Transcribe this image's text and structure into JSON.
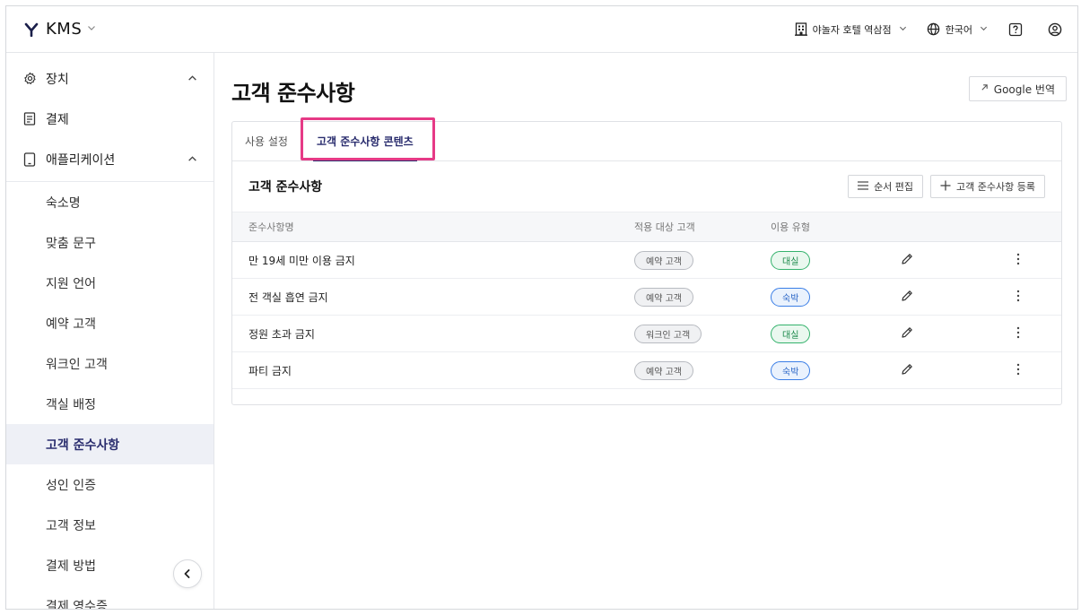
{
  "app": {
    "name": "KMS",
    "property": "야놀자 호텔 역삼점",
    "language": "한국어"
  },
  "sidebar": {
    "groups": [
      {
        "label": "장치",
        "icon": "gear-icon",
        "expanded": true
      },
      {
        "label": "결제",
        "icon": "receipt-icon"
      },
      {
        "label": "애플리케이션",
        "icon": "tablet-icon",
        "expanded": true
      }
    ],
    "items": [
      "숙소명",
      "맞춤 문구",
      "지원 언어",
      "예약 고객",
      "워크인 고객",
      "객실 배정",
      "고객 준수사항",
      "성인 인증",
      "고객 정보",
      "결제 방법",
      "결제 영수증"
    ],
    "active_item": "고객 준수사항"
  },
  "main": {
    "title": "고객 준수사항",
    "google_translate": "Google 번역",
    "tabs": [
      {
        "label": "사용 설정",
        "active": false
      },
      {
        "label": "고객 준수사항 콘텐츠",
        "active": true
      }
    ],
    "section_title": "고객 준수사항",
    "buttons": {
      "reorder": "순서 편집",
      "register": "고객 준수사항 등록"
    },
    "table": {
      "headers": [
        "준수사항명",
        "적용 대상 고객",
        "이용 유형"
      ],
      "rows": [
        {
          "name": "만 19세 미만 이용 금지",
          "target": "예약 고객",
          "type": "대실",
          "type_color": "green"
        },
        {
          "name": "전 객실 흡연 금지",
          "target": "예약 고객",
          "type": "숙박",
          "type_color": "blue"
        },
        {
          "name": "정원 초과 금지",
          "target": "워크인 고객",
          "type": "대실",
          "type_color": "green"
        },
        {
          "name": "파티 금지",
          "target": "예약 고객",
          "type": "숙박",
          "type_color": "blue"
        }
      ]
    }
  },
  "colors": {
    "accent": "#2a2d6e",
    "highlight": "#e63a86",
    "green": "#34b26c",
    "blue": "#3a7ee6"
  }
}
